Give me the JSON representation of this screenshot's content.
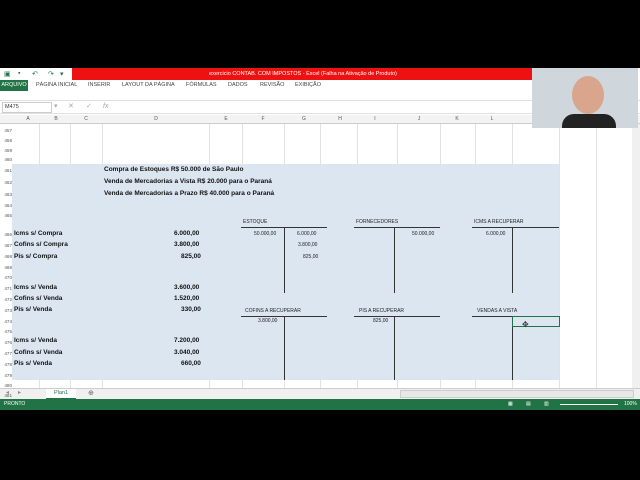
{
  "window": {
    "title": "exercicio CONTAB. COM IMPOSTOS - Excel (Falha na Ativação de Produto)"
  },
  "ribbon": {
    "tabs": [
      "ARQUIVO",
      "PÁGINA INICIAL",
      "INSERIR",
      "LAYOUT DA PÁGINA",
      "FÓRMULAS",
      "DADOS",
      "REVISÃO",
      "EXIBIÇÃO"
    ]
  },
  "formula_bar": {
    "name_box": "M475",
    "fx": "fx",
    "value": ""
  },
  "columns": [
    "A",
    "B",
    "C",
    "D",
    "E",
    "F",
    "G",
    "H",
    "I",
    "J",
    "K",
    "L"
  ],
  "rows": [
    "457",
    "458",
    "459",
    "460",
    "461",
    "462",
    "463",
    "464",
    "465",
    "466",
    "467",
    "468",
    "469",
    "470",
    "471",
    "472",
    "473",
    "474",
    "475",
    "476",
    "477",
    "478",
    "479",
    "480",
    "481"
  ],
  "headings": {
    "line1": "Compra de Estoques R$ 50.000 de São Paulo",
    "line2": "Venda de Mercadorias a Vista R$ 20.000 para o Paraná",
    "line3": "Venda de Mercadorias a Prazo R$ 40.000 para o Paraná"
  },
  "taxes": [
    {
      "label": "Icms s/ Compra",
      "value": "6.000,00"
    },
    {
      "label": "Cofins s/ Compra",
      "value": "3.800,00"
    },
    {
      "label": "Pis s/ Compra",
      "value": "825,00"
    },
    {
      "label": "Icms s/ Venda",
      "value": "3.600,00"
    },
    {
      "label": "Cofins s/ Venda",
      "value": "1.520,00"
    },
    {
      "label": "Pis s/ Venda",
      "value": "330,00"
    },
    {
      "label": "Icms s/ Venda",
      "value": "7.200,00"
    },
    {
      "label": "Cofins s/ Venda",
      "value": "3.040,00"
    },
    {
      "label": "Pis s/ Venda",
      "value": "660,00"
    }
  ],
  "t_accounts": {
    "estoque": {
      "title": "ESTOQUE",
      "debits": [
        "50.000,00"
      ],
      "credits": [
        "6.000,00",
        "3.800,00",
        "825,00"
      ]
    },
    "fornecedores": {
      "title": "FORNECEDORES",
      "debits": [],
      "credits": [
        "50.000,00"
      ]
    },
    "icms": {
      "title": "ICMS A RECUPERAR",
      "debits": [
        "6.000,00"
      ],
      "credits": []
    },
    "cofins": {
      "title": "COFINS A RECUPERAR",
      "debits": [
        "3.800,00"
      ],
      "credits": []
    },
    "pis": {
      "title": "PIS A RECUPERAR",
      "debits": [
        "825,00"
      ],
      "credits": []
    },
    "vendas": {
      "title": "VENDAS A VISTA",
      "debits": [],
      "credits": []
    }
  },
  "sheet": {
    "tab": "Plan1",
    "status": "PRONTO",
    "zoom": "100%"
  }
}
